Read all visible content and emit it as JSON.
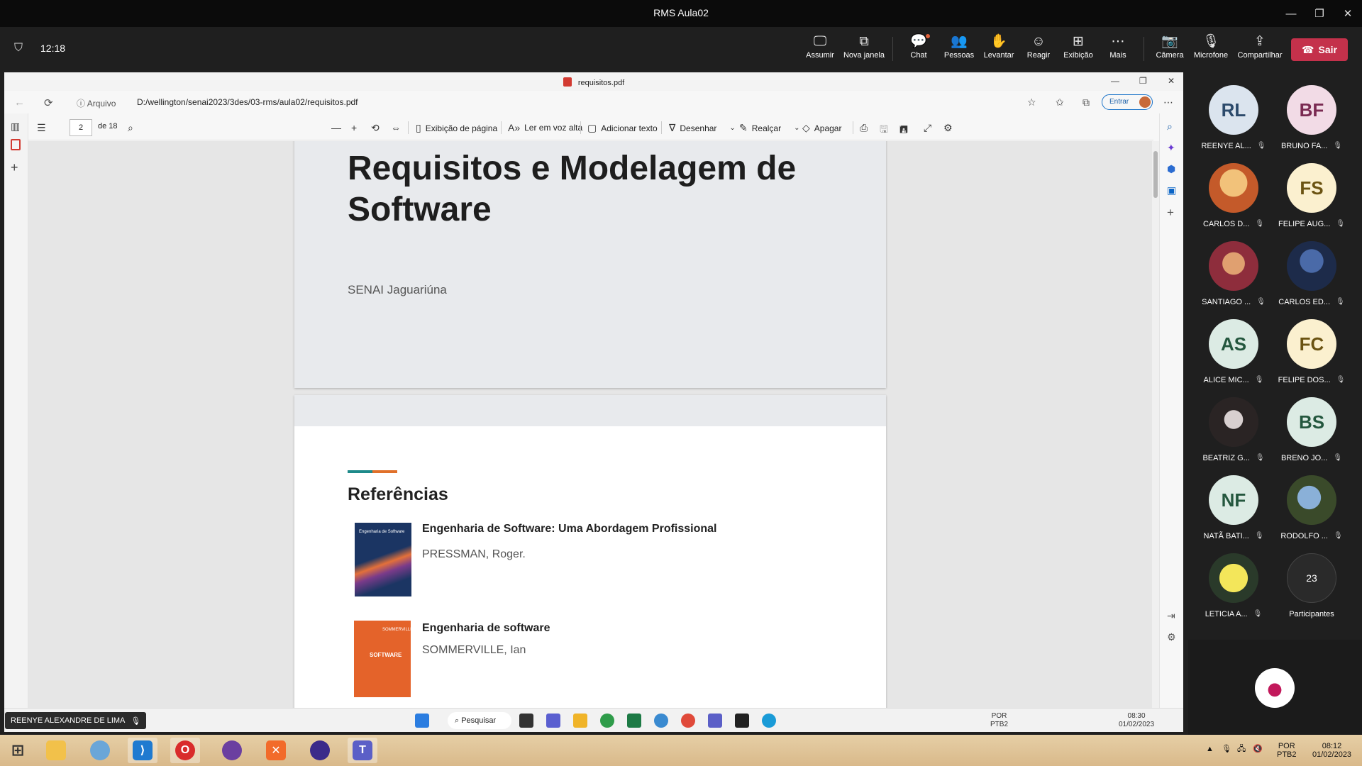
{
  "teams": {
    "window_title": "RMS Aula02",
    "meeting_time": "12:18",
    "toolbar": [
      {
        "label": "Assumir",
        "icon": "take-control-icon"
      },
      {
        "label": "Nova janela",
        "icon": "popout-icon"
      },
      {
        "label": "Chat",
        "icon": "chat-icon"
      },
      {
        "label": "Pessoas",
        "icon": "people-icon"
      },
      {
        "label": "Levantar",
        "icon": "raise-hand-icon"
      },
      {
        "label": "Reagir",
        "icon": "react-icon"
      },
      {
        "label": "Exibição",
        "icon": "view-icon"
      },
      {
        "label": "Mais",
        "icon": "more-icon"
      },
      {
        "label": "Câmera",
        "icon": "camera-off-icon"
      },
      {
        "label": "Microfone",
        "icon": "mic-off-icon"
      },
      {
        "label": "Compartilhar",
        "icon": "share-icon"
      }
    ],
    "leave_label": "Sair",
    "leave_color": "#c4314b",
    "presenter_tag": "REENYE ALEXANDRE DE LIMA",
    "participants": [
      {
        "initials": "RL",
        "name": "REENYE AL...",
        "bg": "#dbe4ee",
        "fg": "#2c4a6b"
      },
      {
        "initials": "BF",
        "name": "BRUNO FA...",
        "bg": "#f2dbe6",
        "fg": "#7a2a52"
      },
      {
        "initials": "",
        "name": "CARLOS D...",
        "bg": "#e39a3c",
        "fg": "#fff"
      },
      {
        "initials": "FS",
        "name": "FELIPE AUG...",
        "bg": "#fbf0cf",
        "fg": "#6b5312"
      },
      {
        "initials": "",
        "name": "SANTIAGO ...",
        "bg": "#8e2d3c",
        "fg": "#fff"
      },
      {
        "initials": "",
        "name": "CARLOS ED...",
        "bg": "#2c3f6b",
        "fg": "#fff"
      },
      {
        "initials": "AS",
        "name": "ALICE MIC...",
        "bg": "#dcebe4",
        "fg": "#24573e"
      },
      {
        "initials": "FC",
        "name": "FELIPE DOS...",
        "bg": "#fbf0cf",
        "fg": "#6b5312"
      },
      {
        "initials": "",
        "name": "BEATRIZ G...",
        "bg": "#3a3434",
        "fg": "#fff"
      },
      {
        "initials": "BS",
        "name": "BRENO JO...",
        "bg": "#dcebe4",
        "fg": "#24573e"
      },
      {
        "initials": "NF",
        "name": "NATÃ BATI...",
        "bg": "#dcebe4",
        "fg": "#24573e"
      },
      {
        "initials": "",
        "name": "RODOLFO ...",
        "bg": "#5b6b3a",
        "fg": "#fff"
      },
      {
        "initials": "",
        "name": "LETICIA A...",
        "bg": "#e8dc3a",
        "fg": "#333"
      }
    ],
    "more_count": "23",
    "more_label": "Participantes"
  },
  "edge": {
    "tab_title": "requisitos.pdf",
    "address_prefix": "Arquivo",
    "address": "D:/wellington/senai2023/3des/03-rms/aula02/requisitos.pdf",
    "signin_label": "Entrar",
    "pdf_toolbar": {
      "page": "2",
      "of": "de 18",
      "page_view": "Exibição de página",
      "read_aloud": "Ler em voz alta",
      "add_text": "Adicionar texto",
      "draw": "Desenhar",
      "highlight": "Realçar",
      "erase": "Apagar"
    }
  },
  "document": {
    "page1_title": "Requisitos e Modelagem de Software",
    "page1_subtitle": "SENAI Jaguariúna",
    "page2_heading": "Referências",
    "refs": [
      {
        "title": "Engenharia de Software: Uma Abordagem Profissional",
        "author": "PRESSMAN, Roger."
      },
      {
        "title": "Engenharia de software",
        "author": "SOMMERVILLE, Ian"
      }
    ],
    "book1_cover_text": "Engenharia de Software",
    "book2_cover_text": "SOFTWARE",
    "book2_cover_top": "SOMMERVILLE"
  },
  "shared_taskbar": {
    "search_label": "Pesquisar",
    "lang": "POR",
    "layout": "PTB2",
    "time": "08:30",
    "date": "01/02/2023"
  },
  "windows_taskbar": {
    "lang": "POR",
    "layout": "PTB2",
    "time": "08:12",
    "date": "01/02/2023"
  }
}
